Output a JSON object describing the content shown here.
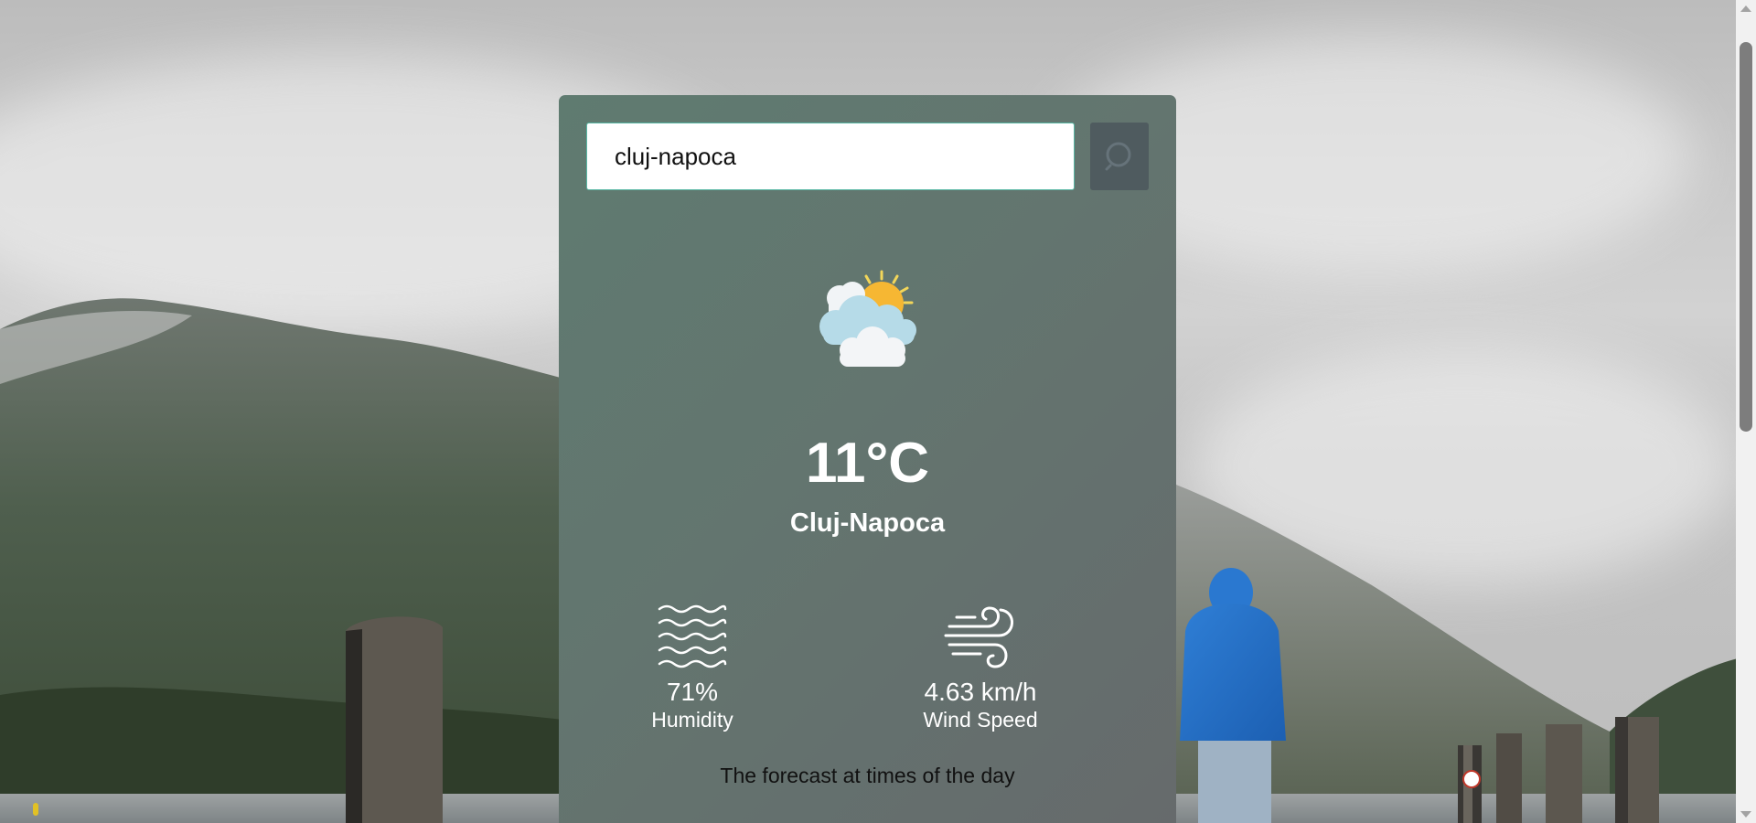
{
  "search": {
    "value": "cluj-napoca",
    "button_icon": "search-icon"
  },
  "weather": {
    "icon": "partly-cloudy-icon",
    "temperature": "11°C",
    "city": "Cluj-Napoca"
  },
  "details": {
    "humidity": {
      "icon": "humidity-waves-icon",
      "value": "71%",
      "label": "Humidity"
    },
    "wind": {
      "icon": "wind-icon",
      "value": "4.63 km/h",
      "label": "Wind Speed"
    }
  },
  "forecast": {
    "heading": "The forecast at times of the day"
  },
  "colors": {
    "card_background": "#627670",
    "search_button": "#4f5b5f",
    "input_border": "#58b6a3",
    "text_light": "#ffffff",
    "text_dark": "#111111"
  }
}
